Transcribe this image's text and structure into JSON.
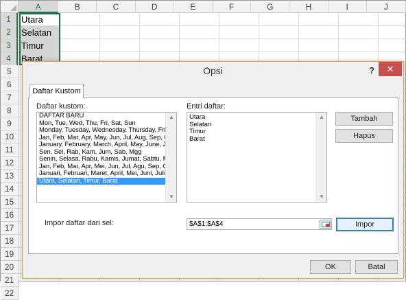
{
  "spreadsheet": {
    "columns": [
      "A",
      "B",
      "C",
      "D",
      "E",
      "F",
      "G",
      "H",
      "I",
      "J"
    ],
    "rows": [
      "1",
      "2",
      "3",
      "4",
      "5",
      "6",
      "7",
      "8",
      "9",
      "10",
      "11",
      "12",
      "13",
      "14",
      "15",
      "16",
      "17",
      "18",
      "19",
      "20",
      "21",
      "22"
    ],
    "cells": [
      "Utara",
      "Selatan",
      "Timur",
      "Barat"
    ]
  },
  "dialog": {
    "title": "Opsi",
    "help": "?",
    "close": "✕",
    "tab": "Daftar Kustom",
    "custom_lists_label": "Daftar kustom:",
    "custom_lists": [
      "DAFTAR BARU",
      "Mon, Tue, Wed, Thu, Fri, Sat, Sun",
      "Monday, Tuesday, Wednesday, Thursday, Frida",
      "Jan, Feb, Mar, Apr, May, Jun, Jul, Aug, Sep, Oc",
      "January, February, March, April, May, June, Jul",
      "Sen, Sel, Rab, Kam, Jum, Sab, Mgg",
      "Senin, Selasa, Rabu, Kamis, Jumat, Sabtu, Ming",
      "Jan, Feb, Mar, Apr, Mei, Jun, Jul, Agu, Sep, Okt",
      "Januari, Februari, Maret, April, Mei, Juni, Juli, A",
      "Utara, Selatan, Timur, Barat"
    ],
    "selected_list_index": 9,
    "entries_label": "Entri daftar:",
    "entries_text": "Utara\nSelatan\nTimur\nBarat",
    "add_button": "Tambah",
    "delete_button": "Hapus",
    "import_label": "Impor daftar dari sel:",
    "import_range": "$A$1:$A$4",
    "import_button": "Impor",
    "ok_button": "OK",
    "cancel_button": "Batal"
  },
  "colors": {
    "excel_green": "#217346",
    "selection_blue": "#3399ff",
    "close_red": "#c75050"
  }
}
